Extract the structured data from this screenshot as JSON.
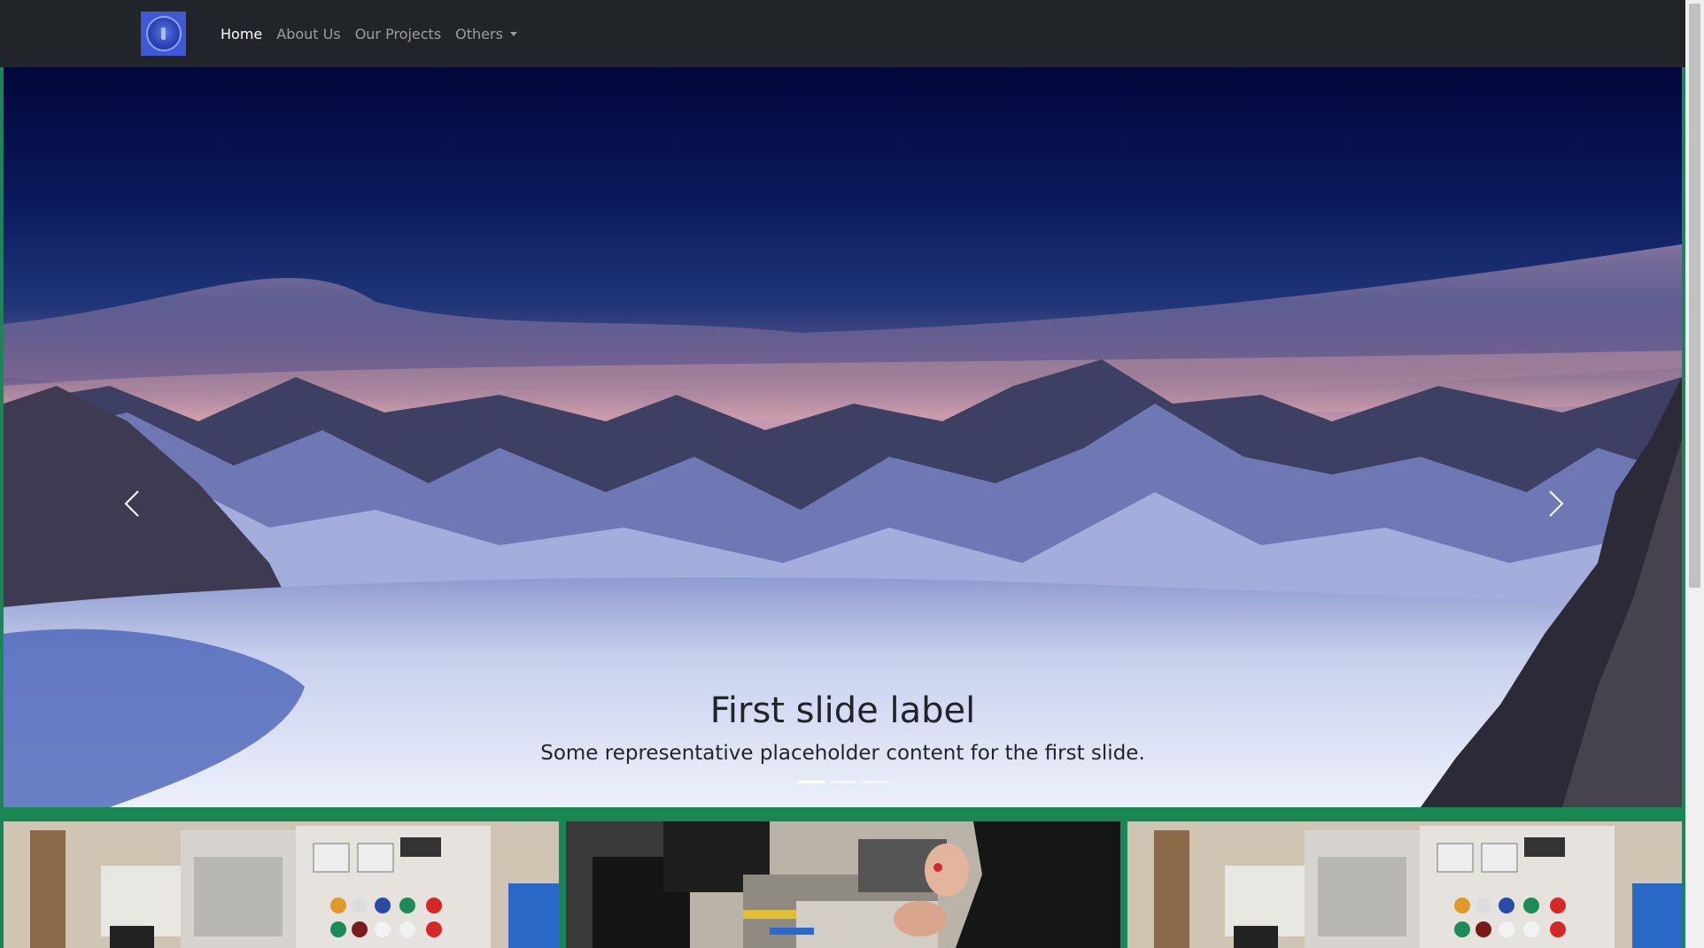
{
  "navbar": {
    "logo_icon": "circle-logo-icon",
    "links": [
      {
        "label": "Home",
        "active": true
      },
      {
        "label": "About Us",
        "active": false
      },
      {
        "label": "Our Projects",
        "active": false
      },
      {
        "label": "Others",
        "active": false,
        "dropdown": true
      }
    ]
  },
  "carousel": {
    "caption_title": "First slide label",
    "caption_text": "Some representative placeholder content for the first slide.",
    "slide_count": 3,
    "active_index": 0,
    "prev_icon": "chevron-left-icon",
    "next_icon": "chevron-right-icon"
  },
  "cards": [
    {
      "image": "lab-control-panel-photo"
    },
    {
      "image": "electronics-workbench-photo"
    },
    {
      "image": "lab-control-panel-photo"
    }
  ],
  "colors": {
    "navbar_bg": "#212529",
    "page_bg": "#198754",
    "active_link": "#ffffff",
    "muted_link": "rgba(255,255,255,0.55)"
  }
}
